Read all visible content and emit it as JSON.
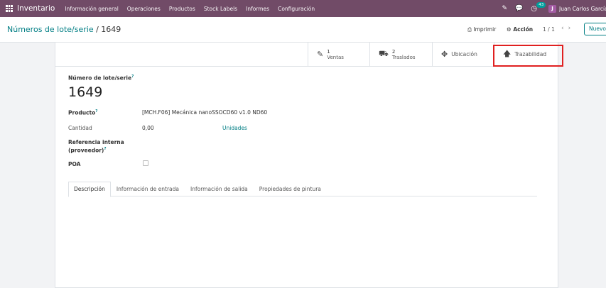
{
  "topbar": {
    "app_name": "Inventario",
    "menu": [
      "Información general",
      "Operaciones",
      "Productos",
      "Stock Labels",
      "Informes",
      "Configuración"
    ],
    "activity_count": "43",
    "user_initial": "J",
    "user_name": "Juan Carlos García Brev"
  },
  "controlbar": {
    "breadcrumb_parent": "Números de lote/serie",
    "breadcrumb_sep": " / ",
    "breadcrumb_current": "1649",
    "print_label": "Imprimir",
    "action_label": "Acción",
    "pager": "1 / 1",
    "new_label": "Nuevo"
  },
  "smart_buttons": {
    "sales": {
      "count": "1",
      "label": "Ventas"
    },
    "transfers": {
      "count": "2",
      "label": "Traslados"
    },
    "location": {
      "label": "Ubicación"
    },
    "traceability": {
      "label": "Trazabilidad"
    }
  },
  "form": {
    "title_label": "Número de lote/serie",
    "tooltip_mark": "?",
    "title_value": "1649",
    "product_label": "Producto",
    "product_value": "[MCH.F06] Mecánica nanoSSOCD60 v1.0 ND60",
    "quantity_label": "Cantidad",
    "quantity_value": "0,00",
    "quantity_unit": "Unidades",
    "ref_label_line1": "Referencia interna",
    "ref_label_line2": "(proveedor)",
    "poa_label": "POA"
  },
  "tabs": [
    "Descripción",
    "Información de entrada",
    "Información de salida",
    "Propiedades de pintura"
  ],
  "colors": {
    "topbar": "#714b67",
    "link": "#017e84",
    "highlight": "#e02020"
  }
}
